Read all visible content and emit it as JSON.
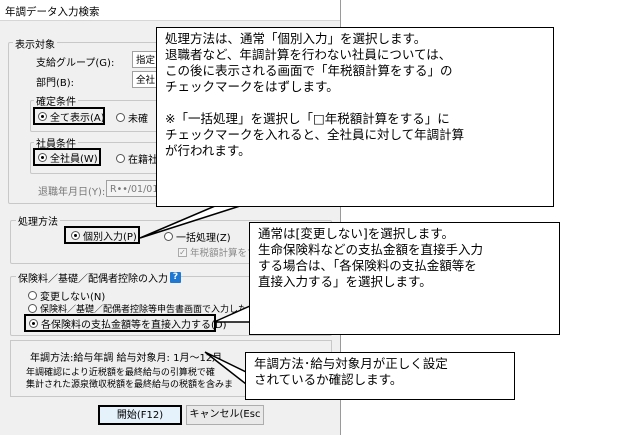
{
  "window": {
    "title": "年調データ入力検索"
  },
  "target": {
    "group_label": "表示対象",
    "pay_group_label": "支給グループ(G):",
    "pay_group_value": "指定",
    "department_label": "部門(B):",
    "department_value": "全社"
  },
  "confirm": {
    "group_label": "確定条件",
    "all_label": "全て表示(A)",
    "unconfirmed_label": "未確"
  },
  "employee": {
    "group_label": "社員条件",
    "all_label": "全社員(W)",
    "enrolled_label": "在籍社"
  },
  "retire": {
    "label": "退職年月日(Y):",
    "value": "R••/01/01"
  },
  "method": {
    "group_label": "処理方法",
    "individual_label": "個別入力(P)",
    "bulk_label": "一括処理(Z)",
    "tax_calc_label": "年税額計算をす"
  },
  "insurance": {
    "group_label": "保険料／基礎／配偶者控除の入力",
    "help_icon": "?",
    "no_change_label": "変更しない(N)",
    "input_label": "保険料／基礎／配偶者控除等申告書画面で入力した",
    "direct_label": "各保険料の支払金額等を直接入力する(D)"
  },
  "summary": {
    "line1": "年調方法:給与年調  給与対象月: 1月～12月",
    "line2": "年調確認により近税額を最終給与の引算税で確",
    "line3": "集計された源泉徴収税額を最終給与の税額を含みま"
  },
  "buttons": {
    "start": "開始(F12)",
    "cancel": "キャンセル(Esc"
  },
  "callouts": {
    "method": "処理方法は、通常「個別入力」を選択します。\n退職者など、年調計算を行わない社員については、\nこの後に表示される画面で「年税額計算をする」の\nチェックマークをはずします。\n\n※「一括処理」を選択し「□年税額計算をする」に\nチェックマークを入れると、全社員に対して年調計算\nが行われます。",
    "insurance": "通常は[変更しない]を選択します。\n生命保険料などの支払金額を直接手入力\nする場合は、「各保険料の支払金額等を\n直接入力する」を選択します。",
    "settings": "年調方法･給与対象月が正しく設定\nされているか確認します。"
  }
}
